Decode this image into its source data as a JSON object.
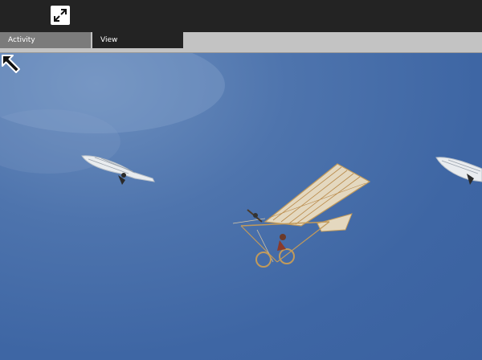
{
  "toolbar": {
    "fullscreen_icon": "fullscreen-expand-icon"
  },
  "tabs": [
    {
      "label": "Activity"
    },
    {
      "label": "View"
    }
  ],
  "scene": {
    "sky_color": "#3e66a4",
    "objects": [
      "glider-left",
      "airplane-center",
      "glider-right"
    ],
    "cursor_icon": "arrow-cursor-icon"
  }
}
